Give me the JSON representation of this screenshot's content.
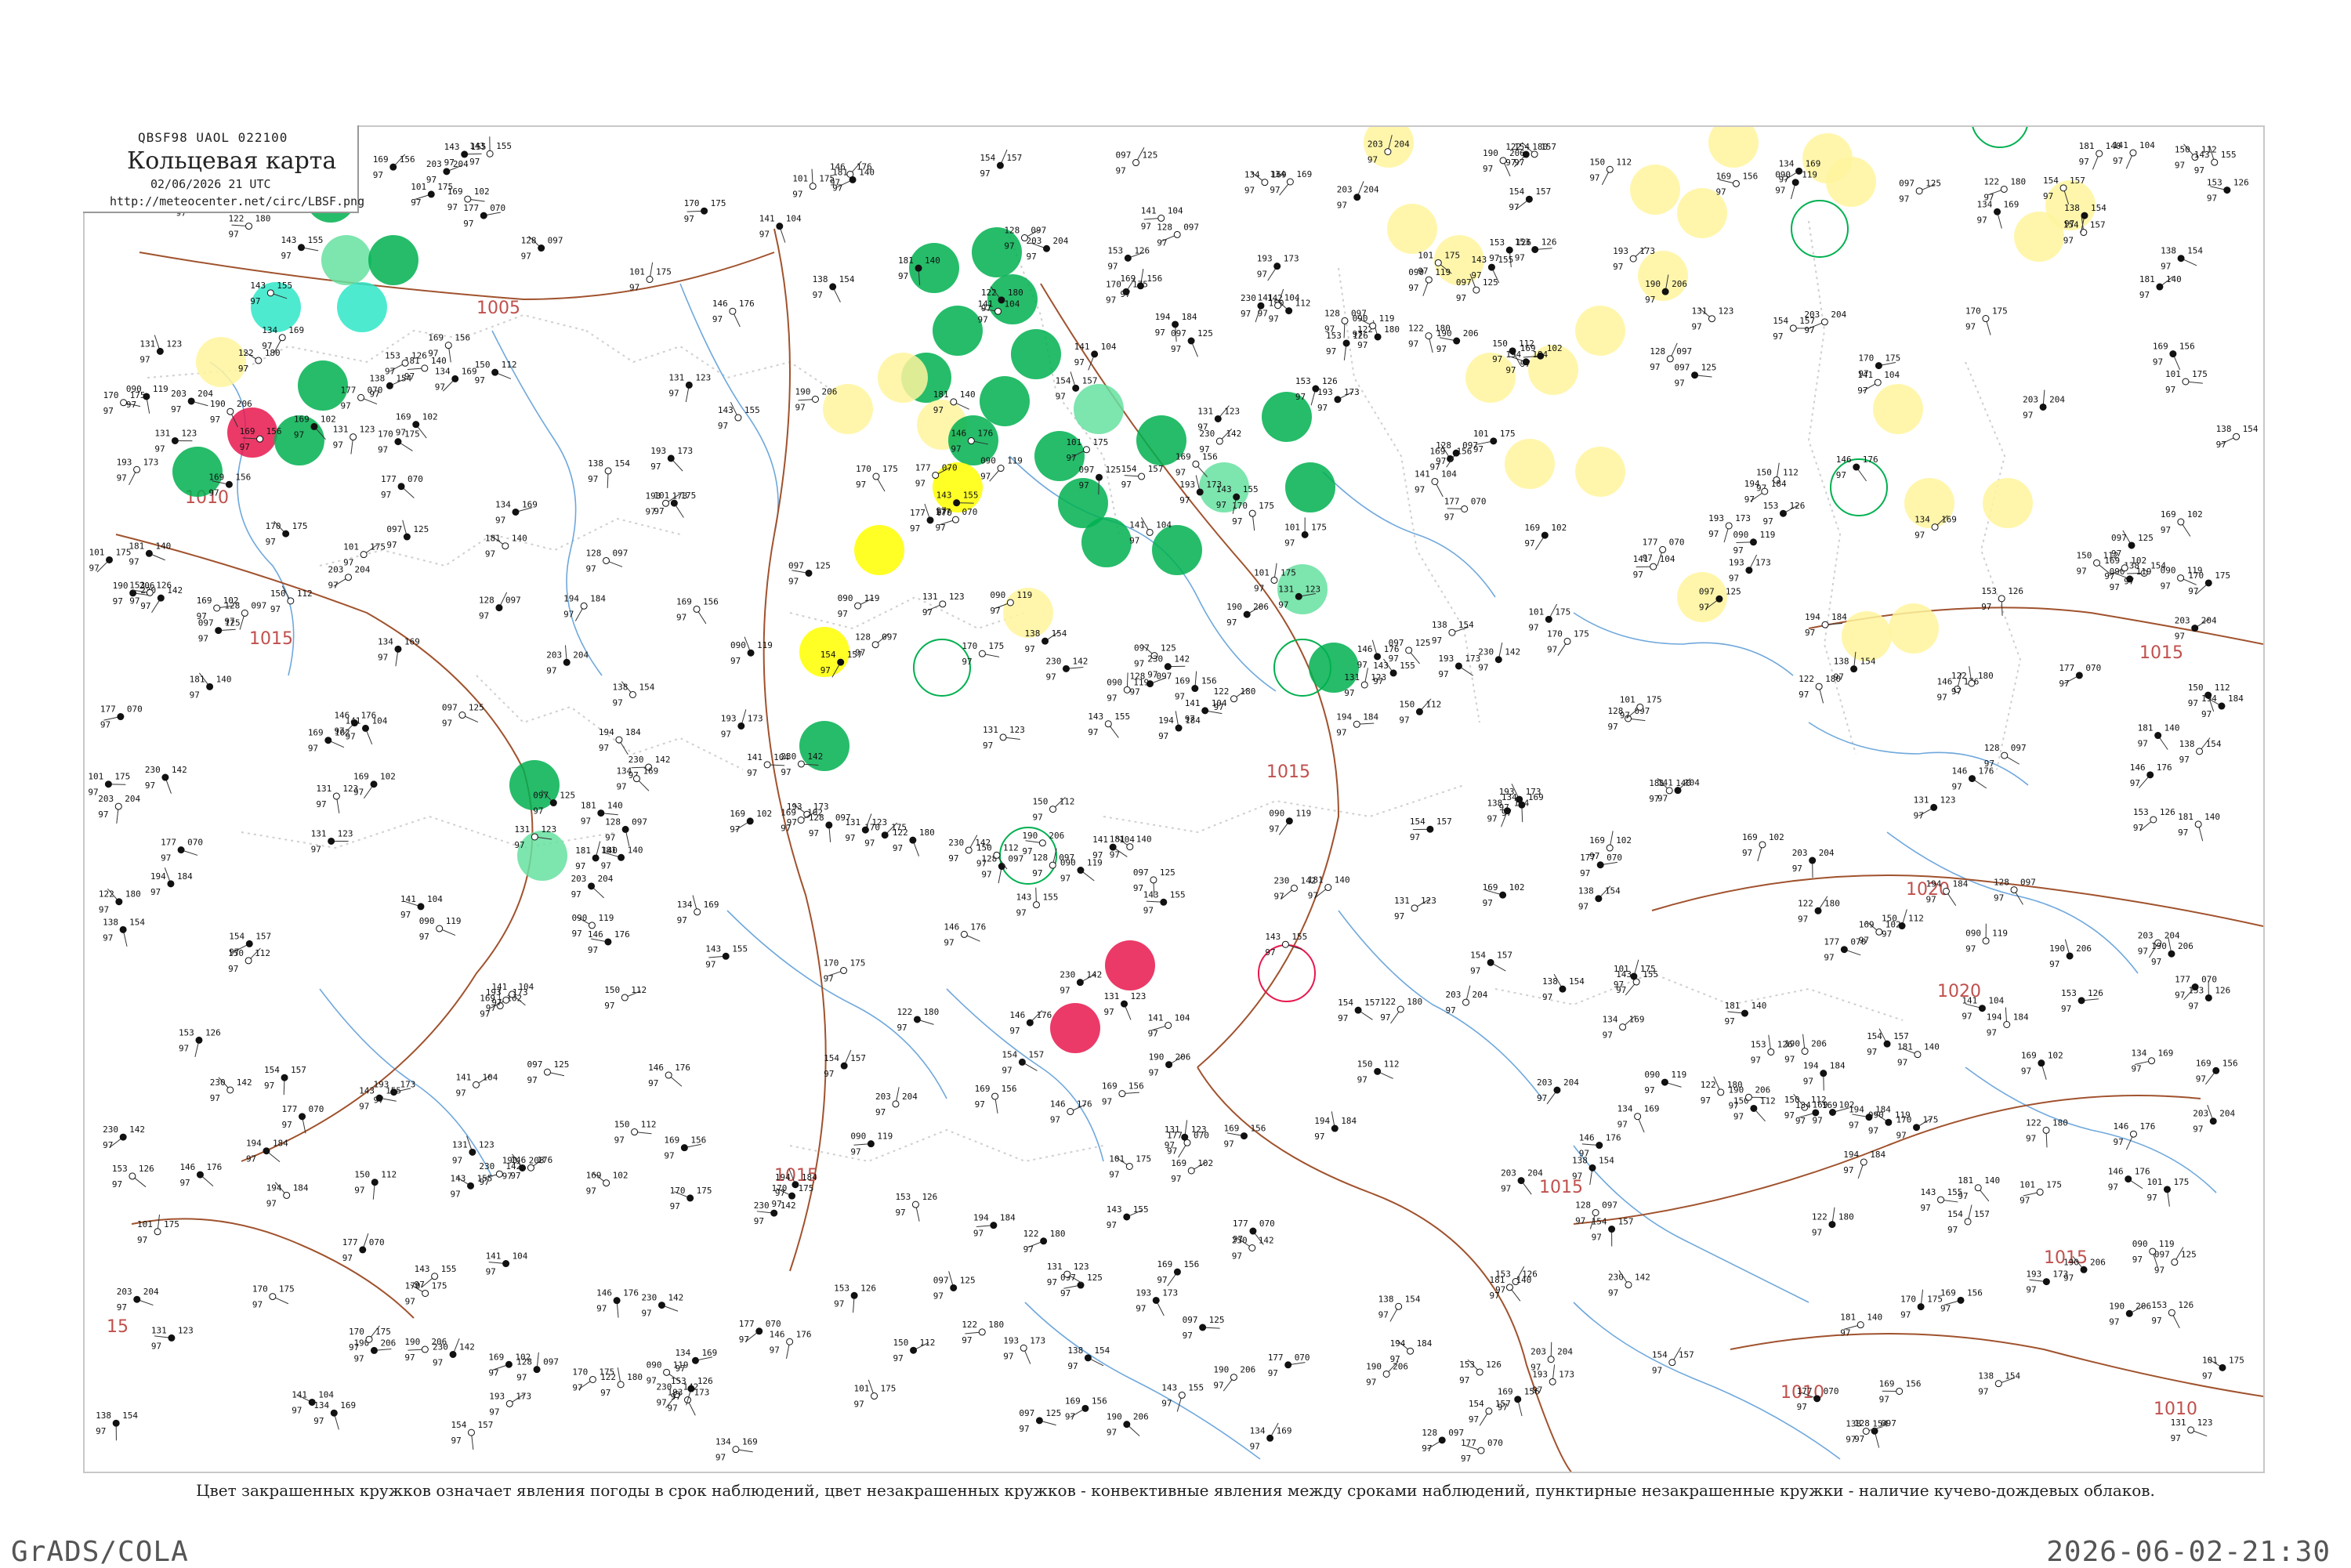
{
  "header": {
    "code_line": "QBSF98  UAOL  022100",
    "title": "Кольцевая карта",
    "datetime": "02/06/2026 21 UTC",
    "url": "http://meteocenter.net/circ/LBSF.png"
  },
  "legend_note": "Цвет закрашенных кружков означает явления погоды в срок наблюдений, цвет незакрашенных кружков - конвективные явления между сроками наблюдений, пунктирные незакрашенные кружки - наличие кучево-дождевых облаков.",
  "footer": {
    "left": "GrADS/COLA",
    "right": "2026-06-02-21:30"
  },
  "colors": {
    "isobar": "#c0504d",
    "water": "#6fa8dc",
    "border": "#d9d9d9",
    "green": "#00b050",
    "yellow": "#ffff00",
    "light_yellow": "#fff59d",
    "cyan": "#2ee6c8",
    "orange": "#f5b041",
    "red": "#e8174d",
    "light_green": "#66e0a0"
  },
  "isobars": [
    "1005",
    "1010",
    "1015",
    "1015",
    "1015",
    "1015",
    "1015",
    "1020",
    "1020",
    "1015",
    "1010",
    "1010",
    "15"
  ],
  "stations": [
    {
      "label": "097",
      "label2": "125"
    },
    {
      "label": "150",
      "label2": "112"
    },
    {
      "label": "131",
      "label2": "123"
    },
    {
      "label": "153",
      "label2": "126"
    },
    {
      "label": "169",
      "label2": "102"
    },
    {
      "label": "177",
      "label2": "070"
    },
    {
      "label": "141",
      "label2": "104"
    },
    {
      "label": "128",
      "label2": "097"
    },
    {
      "label": "154",
      "label2": "157"
    },
    {
      "label": "101",
      "label2": "175"
    },
    {
      "label": "090",
      "label2": "119"
    },
    {
      "label": "146",
      "label2": "176"
    },
    {
      "label": "143",
      "label2": "155"
    },
    {
      "label": "170",
      "label2": "175"
    },
    {
      "label": "181",
      "label2": "140"
    },
    {
      "label": "138",
      "label2": "154"
    },
    {
      "label": "122",
      "label2": "180"
    },
    {
      "label": "193",
      "label2": "173"
    },
    {
      "label": "169",
      "label2": "156"
    },
    {
      "label": "190",
      "label2": "206"
    },
    {
      "label": "134",
      "label2": "169"
    },
    {
      "label": "203",
      "label2": "204"
    },
    {
      "label": "230",
      "label2": "142"
    },
    {
      "label": "194",
      "label2": "184"
    }
  ]
}
